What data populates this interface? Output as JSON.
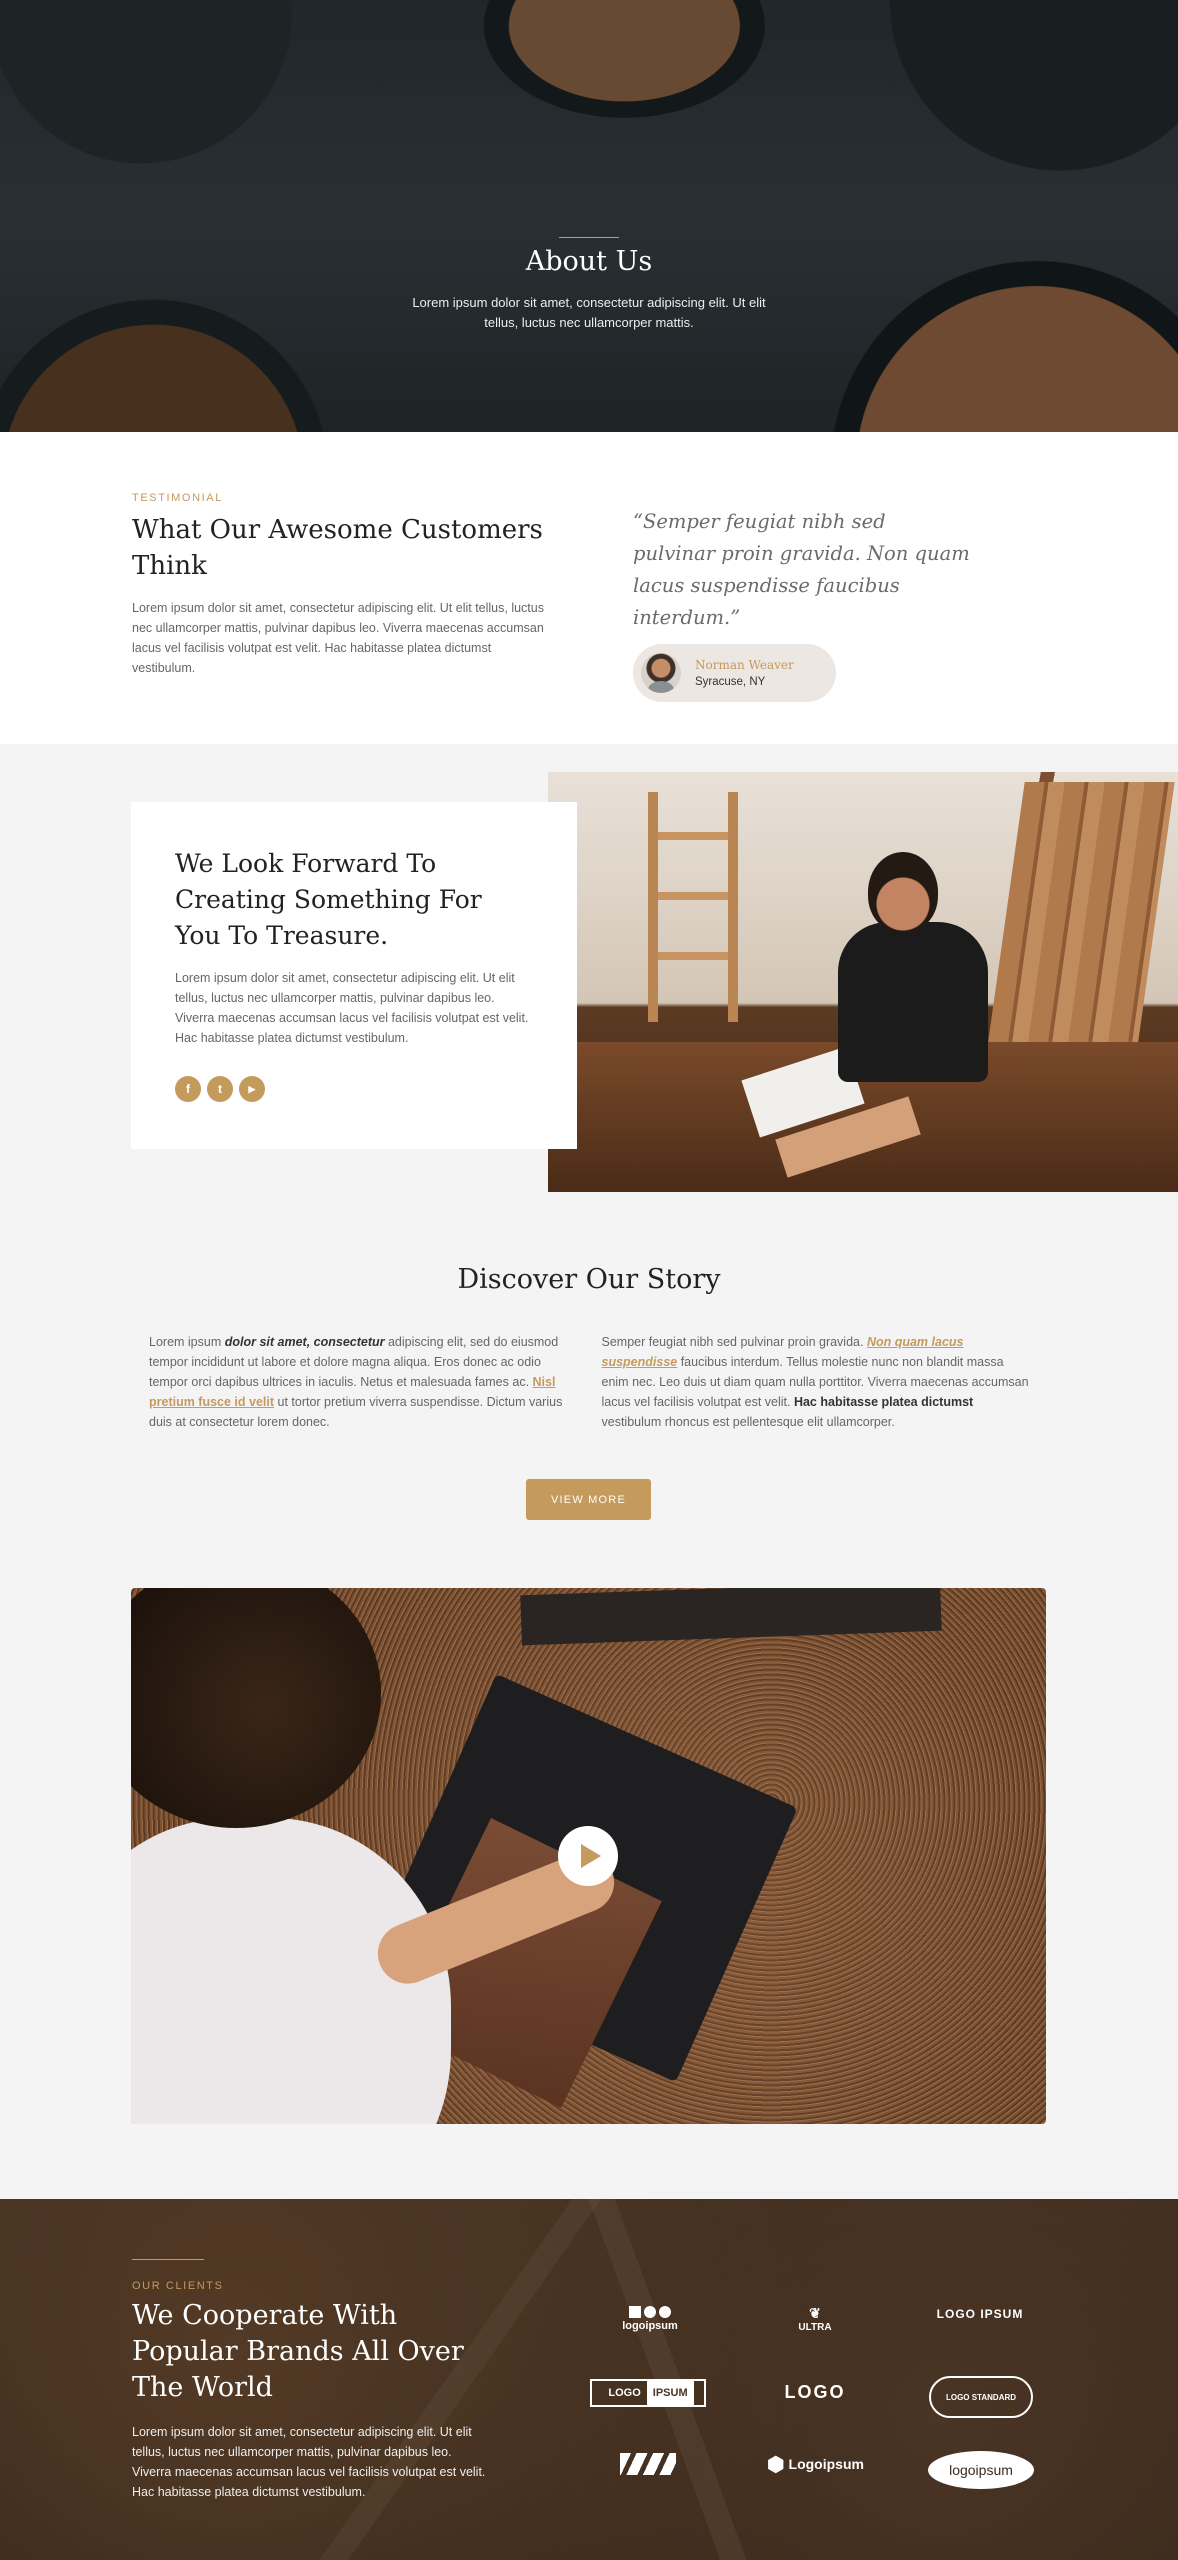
{
  "hero": {
    "title": "About Us",
    "subtitle": "Lorem ipsum dolor sit amet, consectetur adipiscing elit. Ut elit tellus, luctus nec ullamcorper mattis."
  },
  "testimonial": {
    "eyebrow": "TESTIMONIAL",
    "heading": "What Our Awesome Customers Think",
    "body": "Lorem ipsum dolor sit amet, consectetur adipiscing elit. Ut elit tellus, luctus nec ullamcorper mattis, pulvinar dapibus leo. Viverra maecenas accumsan lacus vel facilisis volutpat est velit. Hac habitasse platea dictumst vestibulum.",
    "quote": "“Semper feugiat nibh sed pulvinar proin gravida. Non quam lacus suspendisse faucibus interdum.”",
    "author_name": "Norman Weaver",
    "author_location": "Syracuse, NY"
  },
  "forward": {
    "heading": "We Look Forward To Creating Something For You To Treasure.",
    "body": "Lorem ipsum dolor sit amet, consectetur adipiscing elit. Ut elit tellus, luctus nec ullamcorper mattis, pulvinar dapibus leo. Viverra maecenas accumsan lacus vel facilisis volutpat est velit. Hac habitasse platea dictumst vestibulum.",
    "socials": [
      {
        "icon": "facebook-icon",
        "glyph": "f"
      },
      {
        "icon": "twitter-icon",
        "glyph": "t"
      },
      {
        "icon": "youtube-icon",
        "glyph": "▶"
      }
    ]
  },
  "story": {
    "heading": "Discover Our Story",
    "col1": {
      "t1": "Lorem ipsum ",
      "b1": "dolor sit amet, consectetur",
      "t2": " adipiscing elit, sed do eiusmod tempor incididunt ut labore et dolore magna aliqua. Eros donec ac odio tempor orci dapibus ultrices in iaculis. Netus et malesuada fames ac. ",
      "link": "Nisl pretium fusce id velit",
      "t3": " ut tortor pretium viverra suspendisse. Dictum varius duis at consectetur lorem donec."
    },
    "col2": {
      "t1": "Semper feugiat nibh sed pulvinar proin gravida. ",
      "link": "Non quam lacus suspendisse",
      "t2": " faucibus interdum. Tellus molestie nunc non blandit massa enim nec. Leo duis ut diam quam nulla porttitor. Viverra maecenas accumsan lacus vel facilisis volutpat est velit. ",
      "b1": "Hac habitasse platea dictumst",
      "t3": " vestibulum rhoncus est pellentesque elit ullamcorper."
    },
    "button": "VIEW MORE"
  },
  "clients": {
    "eyebrow": "OUR CLIENTS",
    "heading": "We Cooperate With Popular Brands All Over The World",
    "body": "Lorem ipsum dolor sit amet, consectetur adipiscing elit. Ut elit tellus, luctus nec ullamcorper mattis, pulvinar dapibus leo. Viverra maecenas accumsan lacus vel facilisis volutpat est velit. Hac habitasse platea dictumst vestibulum.",
    "logos": {
      "l1": "logoipsum",
      "l2": "ULTRA",
      "l3": "LOGO IPSUM",
      "l4a": "LOGO",
      "l4b": "IPSUM",
      "l5": "LOGO",
      "l6": "LOGO STANDARD",
      "l8": "Logoipsum",
      "l9": "logoipsum"
    }
  }
}
